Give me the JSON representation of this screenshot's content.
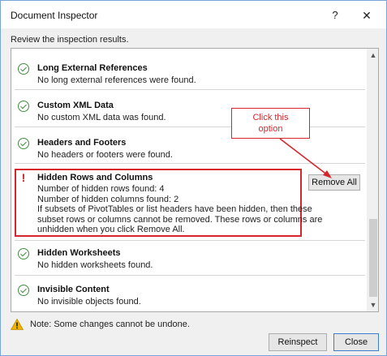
{
  "window": {
    "title": "Document Inspector",
    "help": "?",
    "close": "✕"
  },
  "subtitle": "Review the inspection results.",
  "items": [
    {
      "status": "ok",
      "name": "Long External References",
      "desc": [
        "No long external references were found."
      ]
    },
    {
      "status": "ok",
      "name": "Custom XML Data",
      "desc": [
        "No custom XML data was found."
      ]
    },
    {
      "status": "ok",
      "name": "Headers and Footers",
      "desc": [
        "No headers or footers were found."
      ]
    },
    {
      "status": "warning",
      "name": "Hidden Rows and Columns",
      "desc": [
        "Number of hidden rows found: 4",
        "Number of hidden columns found: 2",
        "If subsets of PivotTables or list headers have been hidden, then these",
        "subset rows or columns cannot be removed. These rows or columns are",
        "unhidden when you click Remove All."
      ],
      "action": "Remove All"
    },
    {
      "status": "ok",
      "name": "Hidden Worksheets",
      "desc": [
        "No hidden worksheets found."
      ]
    },
    {
      "status": "ok",
      "name": "Invisible Content",
      "desc": [
        "No invisible objects found."
      ]
    }
  ],
  "callout": {
    "line1": "Click this",
    "line2": "option"
  },
  "note": "Note: Some changes cannot be undone.",
  "buttons": {
    "reinspect": "Reinspect",
    "close": "Close"
  },
  "colors": {
    "accent_red": "#d7262b",
    "ok_green": "#3f8f3f",
    "warning_red": "#cc1f1f",
    "warning_yellow": "#f0b400"
  }
}
